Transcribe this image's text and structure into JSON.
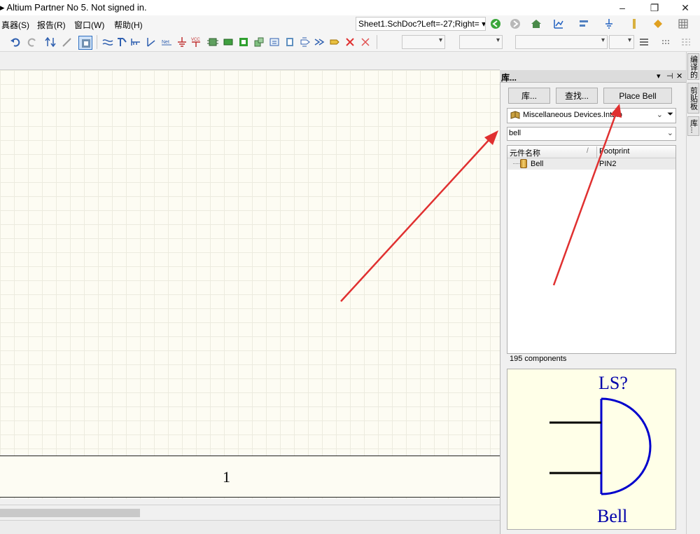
{
  "window": {
    "title": "▸ Altium Partner No 5. Not signed in.",
    "controls": [
      "–",
      "❐",
      "✕"
    ]
  },
  "menu": [
    {
      "label": "真器(S)"
    },
    {
      "label": "报告(R)"
    },
    {
      "label": "窗口(W)"
    },
    {
      "label": "帮助(H)"
    }
  ],
  "document_selector": "Sheet1.SchDoc?Left=-27;Right= ▾",
  "sheet": {
    "zone_label": "1"
  },
  "library_panel": {
    "title": "库...",
    "header_icons": [
      "▾",
      "⊣",
      "✕"
    ],
    "buttons": {
      "libraries": "库...",
      "search": "查找...",
      "place": "Place Bell"
    },
    "library_name": "Miscellaneous Devices.IntLib",
    "filter_value": "bell",
    "columns": [
      "元件名称",
      "Footprint"
    ],
    "components": [
      {
        "name": "Bell",
        "footprint": "PIN2"
      }
    ],
    "count_text": "195 components",
    "preview": {
      "designator": "LS?",
      "comment": "Bell",
      "symbol_color": "#0000cc",
      "pin_color": "#000000"
    }
  },
  "side_tabs": [
    "编译的",
    "剪贴板",
    "库..."
  ],
  "annotation_color": "#e03030"
}
